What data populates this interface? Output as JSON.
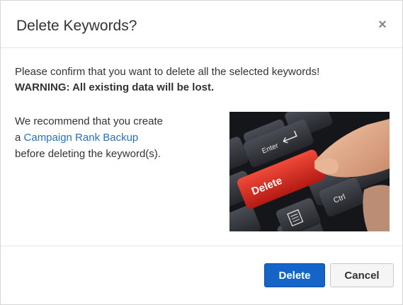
{
  "dialog": {
    "title": "Delete Keywords?",
    "close_symbol": "×",
    "close_icon": "close-icon"
  },
  "body": {
    "confirm_text": "Please confirm that you want to delete all the selected keywords!",
    "warning_text": "WARNING: All existing data will be lost.",
    "recommend_line1": "We recommend that you create",
    "recommend_prefix": "a ",
    "backup_link": "Campaign Rank Backup",
    "recommend_line3": "before deleting the keyword(s).",
    "image": {
      "key_delete": "Delete",
      "key_enter": "Enter",
      "key_ctrl": "Ctrl"
    }
  },
  "footer": {
    "delete_label": "Delete",
    "cancel_label": "Cancel"
  },
  "colors": {
    "primary": "#1565c8",
    "link": "#2a6ebb",
    "delete_key": "#d9261c"
  }
}
